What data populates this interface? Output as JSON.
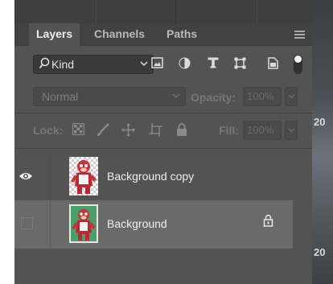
{
  "canvas_background": {
    "labels": [
      "20",
      "20"
    ],
    "colors": {
      "page": "#ffffff",
      "strip": "#4c5057"
    }
  },
  "panel": {
    "tabs": [
      {
        "label": "Layers",
        "active": true
      },
      {
        "label": "Channels",
        "active": false
      },
      {
        "label": "Paths",
        "active": false
      }
    ],
    "menu_icon": "hamburger-menu-icon",
    "filter": {
      "kind_label": "Kind",
      "icons": [
        "pixel-layer-filter-icon",
        "adjustment-layer-filter-icon",
        "type-layer-filter-icon",
        "shape-layer-filter-icon",
        "smart-object-filter-icon"
      ],
      "toggle": "filter-toggle"
    },
    "blend": {
      "mode": "Normal",
      "opacity_label": "Opacity:",
      "opacity_value": "100%"
    },
    "lock": {
      "label": "Lock:",
      "icons": [
        "lock-transparent-pixels-icon",
        "lock-image-pixels-icon",
        "lock-position-icon",
        "lock-artboard-icon",
        "lock-all-icon"
      ],
      "fill_label": "Fill:",
      "fill_value": "100%"
    },
    "layers": [
      {
        "name": "Background copy",
        "visible": true,
        "selected": false,
        "locked": false
      },
      {
        "name": "Background",
        "visible": false,
        "selected": true,
        "locked": true
      }
    ],
    "colors": {
      "panel_bg": "#535353",
      "tab_bar": "#424242",
      "selected_row": "#6a6a6a",
      "text": "#f0f0f0",
      "dim_text": "#777777"
    }
  }
}
